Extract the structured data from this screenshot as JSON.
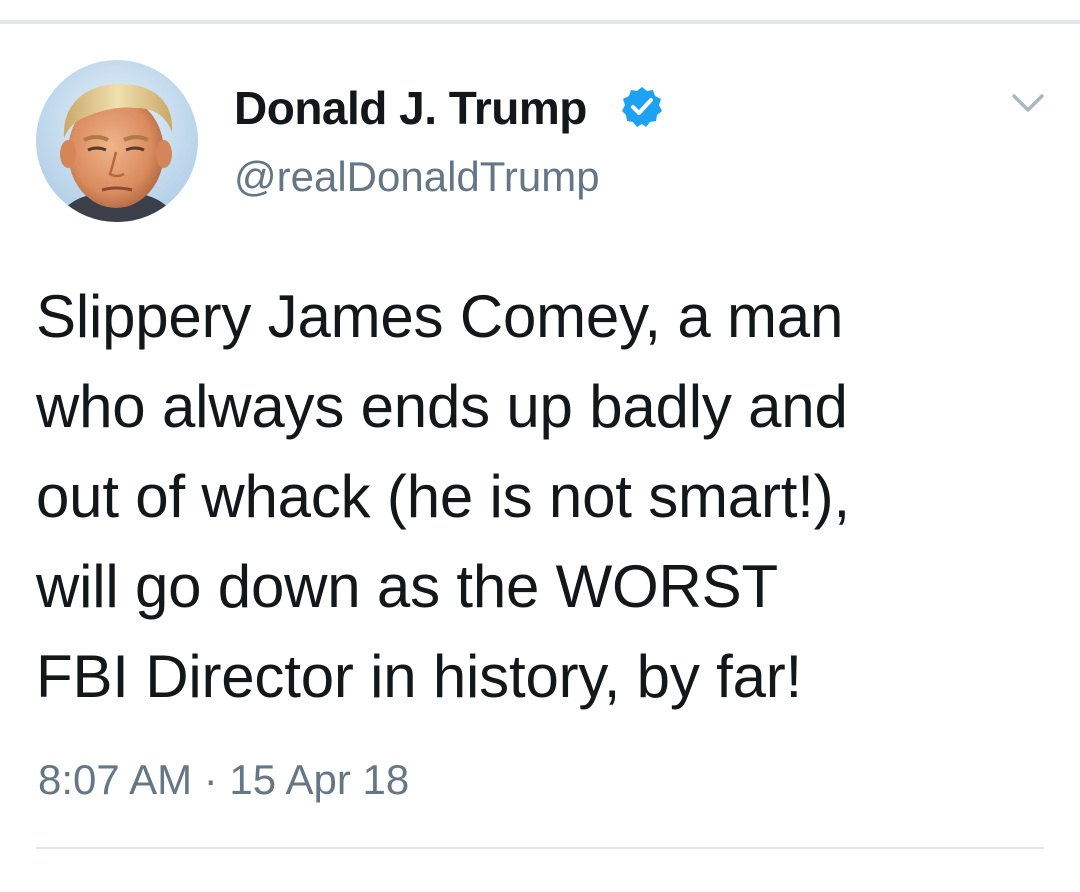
{
  "tweet": {
    "author": {
      "display_name": "Donald J. Trump",
      "handle": "@realDonaldTrump",
      "verified": true,
      "avatar_icon": "profile-photo"
    },
    "text_lines": [
      "Slippery James Comey, a man",
      "who always ends up badly and",
      "out of whack (he is not smart!),",
      "will go down as the WORST",
      "FBI Director in history, by far!"
    ],
    "timestamp": "8:07 AM · 15 Apr 18",
    "more_icon": "chevron-down-icon"
  },
  "colors": {
    "text_primary": "#14171a",
    "text_secondary": "#657786",
    "verified_blue": "#1da1f2",
    "divider": "#e1e8ed",
    "background": "#ffffff"
  }
}
